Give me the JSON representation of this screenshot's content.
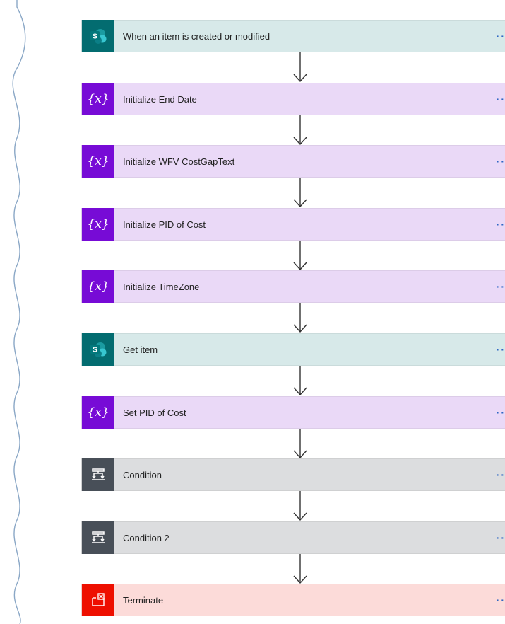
{
  "steps": [
    {
      "label": "When an item is created or modified",
      "kind": "sharepoint",
      "icon": "sharepoint-icon",
      "bg": "#d7e9e9",
      "iconbg": "#036c70"
    },
    {
      "label": "Initialize End Date",
      "kind": "variable",
      "icon": "variable-icon",
      "bg": "#ead9f7",
      "iconbg": "#770bd6"
    },
    {
      "label": "Initialize WFV CostGapText",
      "kind": "variable",
      "icon": "variable-icon",
      "bg": "#ead9f7",
      "iconbg": "#770bd6"
    },
    {
      "label": "Initialize PID of Cost",
      "kind": "variable",
      "icon": "variable-icon",
      "bg": "#ead9f7",
      "iconbg": "#770bd6"
    },
    {
      "label": "Initialize TimeZone",
      "kind": "variable",
      "icon": "variable-icon",
      "bg": "#ead9f7",
      "iconbg": "#770bd6"
    },
    {
      "label": "Get item",
      "kind": "sharepoint",
      "icon": "sharepoint-icon",
      "bg": "#d7e9e9",
      "iconbg": "#036c70"
    },
    {
      "label": "Set PID of Cost",
      "kind": "variable",
      "icon": "variable-icon",
      "bg": "#ead9f7",
      "iconbg": "#770bd6"
    },
    {
      "label": "Condition",
      "kind": "condition",
      "icon": "condition-icon",
      "bg": "#dcdddf",
      "iconbg": "#484f58"
    },
    {
      "label": "Condition 2",
      "kind": "condition",
      "icon": "condition-icon",
      "bg": "#dcdddf",
      "iconbg": "#484f58"
    },
    {
      "label": "Terminate",
      "kind": "terminate",
      "icon": "terminate-icon",
      "bg": "#fcdbd9",
      "iconbg": "#ee0f00"
    }
  ],
  "more_label": "··",
  "variable_symbol": "{x}"
}
